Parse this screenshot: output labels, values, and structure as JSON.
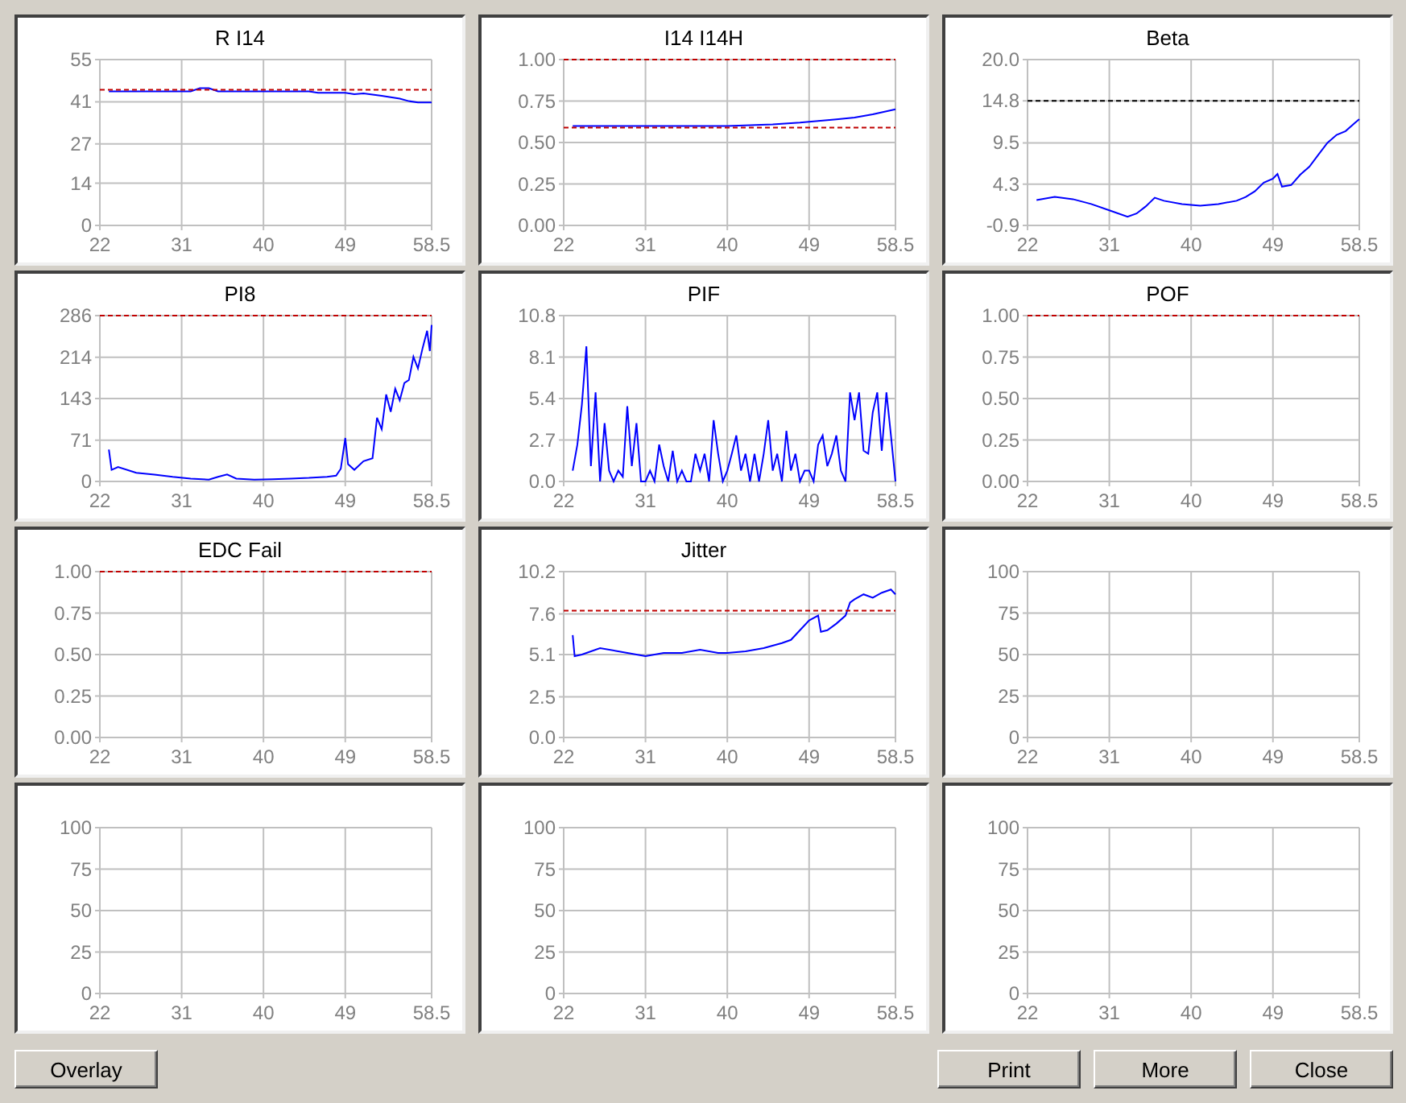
{
  "charts": [
    {
      "title": "R I14",
      "chart_data": {
        "type": "line",
        "grid": true,
        "xlim": [
          22,
          58.5
        ],
        "ylim": [
          0,
          55
        ],
        "xticks": [
          22,
          31,
          40,
          49,
          58.5
        ],
        "yticks": [
          0,
          14,
          27,
          41,
          55
        ],
        "x": [
          22,
          23,
          27,
          31,
          32,
          33,
          34,
          35,
          36,
          40,
          45,
          46,
          49,
          50,
          51,
          53,
          54,
          55,
          56,
          57,
          58.5
        ],
        "series": [
          {
            "color": "#0000ff",
            "values": [
              null,
              44.5,
              44.5,
              44.5,
              44.5,
              45.5,
              45.5,
              44.5,
              44.5,
              44.5,
              44.5,
              44,
              44,
              43.5,
              43.8,
              43,
              42.5,
              42,
              41.2,
              40.8,
              40.8
            ]
          },
          {
            "color": "#c00000",
            "line_style": "dashed",
            "values": [
              45,
              45,
              45,
              45,
              45,
              45,
              45,
              45,
              45,
              45,
              45,
              45,
              45,
              45,
              45,
              45,
              45,
              45,
              45,
              45,
              45
            ]
          }
        ]
      }
    },
    {
      "title": "I14 I14H",
      "chart_data": {
        "type": "line",
        "grid": true,
        "xlim": [
          22,
          58.5
        ],
        "ylim": [
          0,
          1
        ],
        "xticks": [
          22,
          31,
          40,
          49,
          58.5
        ],
        "yticks": [
          {
            "value": 0,
            "label": "0.00"
          },
          0.25,
          {
            "value": 0.5,
            "label": "0.50"
          },
          0.75,
          {
            "value": 1,
            "label": "1.00"
          }
        ],
        "x": [
          22,
          23,
          30,
          40,
          45,
          48,
          50,
          52,
          54,
          56,
          58.5
        ],
        "series": [
          {
            "color": "#0000ff",
            "values": [
              null,
              0.6,
              0.6,
              0.6,
              0.61,
              0.62,
              0.63,
              0.64,
              0.65,
              0.67,
              0.7
            ]
          },
          {
            "color": "#c00000",
            "line_style": "dashed",
            "values": [
              1,
              1,
              1,
              1,
              1,
              1,
              1,
              1,
              1,
              1,
              1
            ]
          },
          {
            "color": "#c00000",
            "line_style": "dashed",
            "values": [
              0.59,
              0.59,
              0.59,
              0.59,
              0.59,
              0.59,
              0.59,
              0.59,
              0.59,
              0.59,
              0.59
            ]
          }
        ]
      }
    },
    {
      "title": "Beta",
      "chart_data": {
        "type": "line",
        "grid": true,
        "xlim": [
          22,
          58.5
        ],
        "ylim": [
          -0.9,
          20
        ],
        "xticks": [
          22,
          31,
          40,
          49,
          58.5
        ],
        "yticks": [
          -0.9,
          4.3,
          9.5,
          14.8,
          {
            "value": 20,
            "label": "20.0"
          }
        ],
        "x": [
          22,
          23,
          25,
          27,
          29,
          31,
          33,
          34,
          35,
          36,
          37,
          39,
          41,
          43,
          45,
          46,
          47,
          48,
          49,
          49.5,
          50,
          51,
          52,
          53,
          54,
          55,
          56,
          57,
          58,
          58.5
        ],
        "series": [
          {
            "color": "#0000ff",
            "values": [
              null,
              2.3,
              2.7,
              2.4,
              1.8,
              1,
              0.2,
              0.6,
              1.5,
              2.6,
              2.2,
              1.8,
              1.6,
              1.8,
              2.2,
              2.7,
              3.4,
              4.5,
              5,
              5.6,
              4,
              4.2,
              5.5,
              6.5,
              8,
              9.5,
              10.5,
              11,
              12,
              12.5
            ]
          },
          {
            "color": "#000000",
            "line_style": "dashed",
            "values": [
              14.8,
              14.8,
              14.8,
              14.8,
              14.8,
              14.8,
              14.8,
              14.8,
              14.8,
              14.8,
              14.8,
              14.8,
              14.8,
              14.8,
              14.8,
              14.8,
              14.8,
              14.8,
              14.8,
              14.8,
              14.8,
              14.8,
              14.8,
              14.8,
              14.8,
              14.8,
              14.8,
              14.8,
              14.8,
              14.8
            ]
          }
        ]
      }
    },
    {
      "title": "PI8",
      "chart_data": {
        "type": "line",
        "grid": true,
        "xlim": [
          22,
          58.5
        ],
        "ylim": [
          0,
          286
        ],
        "xticks": [
          22,
          31,
          40,
          49,
          58.5
        ],
        "yticks": [
          0,
          71,
          143,
          214,
          286
        ],
        "x": [
          22,
          23,
          23.3,
          24,
          26,
          28,
          30,
          32,
          34,
          35,
          36,
          37,
          39,
          41,
          43,
          45,
          47,
          48,
          48.5,
          49,
          49.3,
          50,
          51,
          52,
          52.5,
          53,
          53.5,
          54,
          54.5,
          55,
          55.5,
          56,
          56.5,
          57,
          57.5,
          58,
          58.3,
          58.5
        ],
        "series": [
          {
            "color": "#0000ff",
            "values": [
              null,
              55,
              20,
              25,
              15,
              12,
              8,
              5,
              3,
              8,
              12,
              5,
              3,
              4,
              5,
              6,
              8,
              10,
              22,
              75,
              30,
              20,
              35,
              40,
              110,
              90,
              150,
              120,
              160,
              140,
              170,
              175,
              215,
              195,
              230,
              260,
              225,
              270
            ]
          },
          {
            "color": "#c00000",
            "line_style": "dashed",
            "values": [
              286,
              286,
              286,
              286,
              286,
              286,
              286,
              286,
              286,
              286,
              286,
              286,
              286,
              286,
              286,
              286,
              286,
              286,
              286,
              286,
              286,
              286,
              286,
              286,
              286,
              286,
              286,
              286,
              286,
              286,
              286,
              286,
              286,
              286,
              286,
              286,
              286,
              286
            ]
          }
        ]
      }
    },
    {
      "title": "PIF",
      "chart_data": {
        "type": "line",
        "grid": true,
        "xlim": [
          22,
          58.5
        ],
        "ylim": [
          0,
          10.8
        ],
        "xticks": [
          22,
          31,
          40,
          49,
          58.5
        ],
        "yticks": [
          {
            "value": 0,
            "label": "0.0"
          },
          2.7,
          5.4,
          8.1,
          10.8
        ],
        "x": [
          23,
          23.5,
          24,
          24.5,
          25,
          25.5,
          26,
          26.5,
          27,
          27.5,
          28,
          28.5,
          29,
          29.5,
          30,
          30.5,
          31,
          31.5,
          32,
          32.5,
          33,
          33.5,
          34,
          34.5,
          35,
          35.5,
          36,
          36.5,
          37,
          37.5,
          38,
          38.5,
          39,
          39.5,
          40,
          40.5,
          41,
          41.5,
          42,
          42.5,
          43,
          43.5,
          44,
          44.5,
          45,
          45.5,
          46,
          46.5,
          47,
          47.5,
          48,
          48.5,
          49,
          49.5,
          50,
          50.5,
          51,
          51.5,
          52,
          52.5,
          53,
          53.5,
          54,
          54.5,
          55,
          55.5,
          56,
          56.5,
          57,
          57.5,
          58,
          58.5
        ],
        "series": [
          {
            "color": "#0000ff",
            "values": [
              0.7,
              2.4,
              5,
              8.8,
              1,
              5.8,
              0,
              3.8,
              0.7,
              0,
              0.7,
              0.3,
              4.9,
              1,
              3.8,
              0,
              0,
              0.7,
              0,
              2.4,
              1,
              0,
              2,
              0,
              0.7,
              0,
              0,
              1.8,
              0.7,
              1.8,
              0,
              4,
              1.8,
              0,
              0.7,
              1.8,
              3,
              0.7,
              1.8,
              0,
              1.8,
              0,
              1.8,
              4,
              0.7,
              1.8,
              0,
              3.3,
              0.7,
              1.8,
              0,
              0.7,
              0.7,
              0,
              2.4,
              3,
              1,
              1.8,
              3,
              0.7,
              0,
              5.8,
              4,
              5.8,
              2,
              1.8,
              4.5,
              5.8,
              2,
              5.8,
              3,
              0
            ]
          }
        ]
      }
    },
    {
      "title": "POF",
      "chart_data": {
        "type": "line",
        "grid": true,
        "xlim": [
          22,
          58.5
        ],
        "ylim": [
          0,
          1
        ],
        "xticks": [
          22,
          31,
          40,
          49,
          58.5
        ],
        "yticks": [
          {
            "value": 0,
            "label": "0.00"
          },
          0.25,
          {
            "value": 0.5,
            "label": "0.50"
          },
          0.75,
          {
            "value": 1,
            "label": "1.00"
          }
        ],
        "x": [
          22,
          58.5
        ],
        "series": [
          {
            "color": "#c00000",
            "line_style": "dashed",
            "values": [
              1,
              1
            ]
          }
        ]
      }
    },
    {
      "title": "EDC Fail",
      "chart_data": {
        "type": "line",
        "grid": true,
        "xlim": [
          22,
          58.5
        ],
        "ylim": [
          0,
          1
        ],
        "xticks": [
          22,
          31,
          40,
          49,
          58.5
        ],
        "yticks": [
          {
            "value": 0,
            "label": "0.00"
          },
          0.25,
          {
            "value": 0.5,
            "label": "0.50"
          },
          0.75,
          {
            "value": 1,
            "label": "1.00"
          }
        ],
        "x": [
          22,
          58.5
        ],
        "series": [
          {
            "color": "#c00000",
            "line_style": "dashed",
            "values": [
              1,
              1
            ]
          }
        ]
      }
    },
    {
      "title": "Jitter",
      "chart_data": {
        "type": "line",
        "grid": true,
        "xlim": [
          22,
          58.5
        ],
        "ylim": [
          0,
          10.2
        ],
        "xticks": [
          22,
          31,
          40,
          49,
          58.5
        ],
        "yticks": [
          {
            "value": 0,
            "label": "0.0"
          },
          2.5,
          5.1,
          7.6,
          10.2
        ],
        "x": [
          22,
          23,
          23.2,
          24,
          26,
          28,
          31,
          33,
          35,
          37,
          39,
          40,
          42,
          44,
          46,
          47,
          48,
          49,
          50,
          50.3,
          51,
          52,
          53,
          53.5,
          54,
          55,
          56,
          57,
          58,
          58.5
        ],
        "series": [
          {
            "color": "#0000ff",
            "values": [
              null,
              6.3,
              5,
              5.1,
              5.5,
              5.3,
              5,
              5.2,
              5.2,
              5.4,
              5.2,
              5.2,
              5.3,
              5.5,
              5.8,
              6,
              6.6,
              7.2,
              7.5,
              6.5,
              6.6,
              7,
              7.5,
              8.3,
              8.5,
              8.8,
              8.6,
              8.9,
              9.1,
              8.8
            ]
          },
          {
            "color": "#c00000",
            "line_style": "dashed",
            "values": [
              7.8,
              7.8,
              7.8,
              7.8,
              7.8,
              7.8,
              7.8,
              7.8,
              7.8,
              7.8,
              7.8,
              7.8,
              7.8,
              7.8,
              7.8,
              7.8,
              7.8,
              7.8,
              7.8,
              7.8,
              7.8,
              7.8,
              7.8,
              7.8,
              7.8,
              7.8,
              7.8,
              7.8,
              7.8,
              7.8
            ]
          }
        ]
      }
    },
    {
      "chart_data": {
        "type": "line",
        "grid": true,
        "xlim": [
          22,
          58.5
        ],
        "ylim": [
          0,
          100
        ],
        "xticks": [
          22,
          31,
          40,
          49,
          58.5
        ],
        "yticks": [
          0,
          25,
          50,
          75,
          100
        ]
      }
    },
    {
      "chart_data": {
        "type": "line",
        "grid": true,
        "xlim": [
          22,
          58.5
        ],
        "ylim": [
          0,
          100
        ],
        "xticks": [
          22,
          31,
          40,
          49,
          58.5
        ],
        "yticks": [
          0,
          25,
          50,
          75,
          100
        ]
      }
    },
    {
      "chart_data": {
        "type": "line",
        "grid": true,
        "xlim": [
          22,
          58.5
        ],
        "ylim": [
          0,
          100
        ],
        "xticks": [
          22,
          31,
          40,
          49,
          58.5
        ],
        "yticks": [
          0,
          25,
          50,
          75,
          100
        ]
      }
    },
    {
      "chart_data": {
        "type": "line",
        "grid": true,
        "xlim": [
          22,
          58.5
        ],
        "ylim": [
          0,
          100
        ],
        "xticks": [
          22,
          31,
          40,
          49,
          58.5
        ],
        "yticks": [
          0,
          25,
          50,
          75,
          100
        ]
      }
    }
  ],
  "buttons_left": [
    {
      "label": "Overlay"
    }
  ],
  "buttons_right": [
    {
      "label": "Print"
    },
    {
      "label": "More"
    },
    {
      "label": "Close"
    }
  ]
}
